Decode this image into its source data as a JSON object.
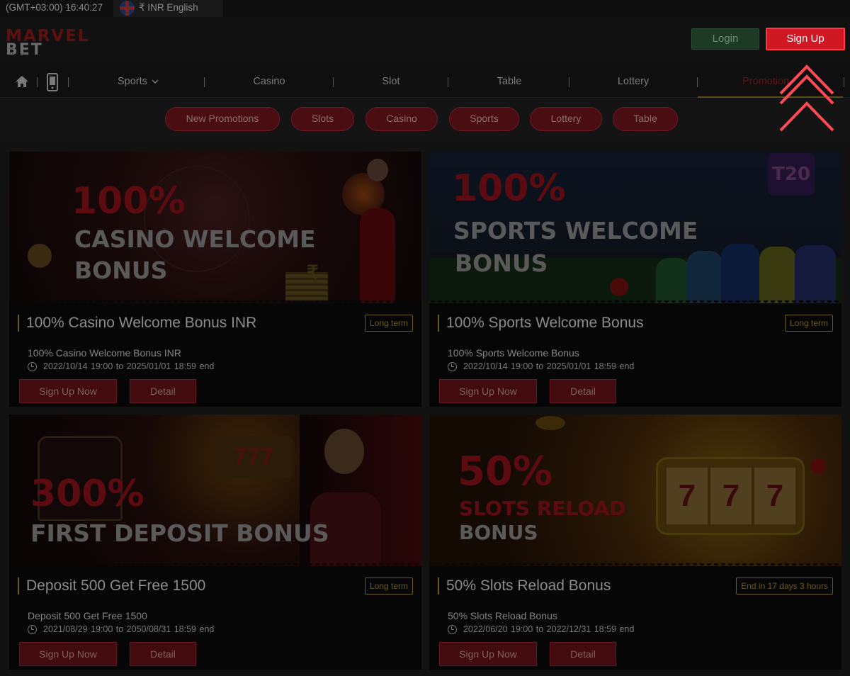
{
  "topbar": {
    "clock": "(GMT+03:00) 16:40:27",
    "currency_language": "₹ INR English",
    "flag_icon": "uk-flag-icon"
  },
  "header": {
    "logo_line1": "MARVEL",
    "logo_line2": "BET",
    "login_label": "Login",
    "signup_label": "Sign Up"
  },
  "nav": {
    "items": [
      {
        "label": "Sports",
        "icon": "chevron-down-icon"
      },
      {
        "label": "Casino"
      },
      {
        "label": "Slot"
      },
      {
        "label": "Table"
      },
      {
        "label": "Lottery"
      },
      {
        "label": "Promotion"
      }
    ],
    "active": "Promotion"
  },
  "filters": [
    "New Promotions",
    "Slots",
    "Casino",
    "Sports",
    "Lottery",
    "Table"
  ],
  "promotions": [
    {
      "banner_big": "100%",
      "banner_line1": "CASINO WELCOME",
      "banner_line2": "BONUS",
      "title": "100% Casino Welcome Bonus INR",
      "tag": "Long term",
      "subtitle": "100% Casino Welcome Bonus INR",
      "dates": "2022/10/14 19:00  to   2025/01/01  18:59  end",
      "signup_label": "Sign Up Now",
      "detail_label": "Detail"
    },
    {
      "banner_big": "100%",
      "banner_line1": "SPORTS WELCOME",
      "banner_line2": "BONUS",
      "banner_badge": "T20",
      "title": "100% Sports Welcome Bonus",
      "tag": "Long term",
      "subtitle": "100% Sports Welcome Bonus",
      "dates": "2022/10/14 19:00  to   2025/01/01  18:59  end",
      "signup_label": "Sign Up Now",
      "detail_label": "Detail"
    },
    {
      "banner_big": "300%",
      "banner_line1": "FIRST DEPOSIT BONUS",
      "banner_line2": "",
      "title": "Deposit 500 Get Free 1500",
      "tag": "Long term",
      "subtitle": "Deposit 500 Get Free 1500",
      "dates": "2021/08/29 19:00  to   2050/08/31  18:59  end",
      "signup_label": "Sign Up Now",
      "detail_label": "Detail"
    },
    {
      "banner_big": "50%",
      "banner_line1": "SLOTS RELOAD",
      "banner_line2": "BONUS",
      "title": "50% Slots Reload Bonus",
      "tag": "End in 17 days 3 hours",
      "subtitle": "50% Slots Reload Bonus",
      "dates": "2022/06/20 19:00  to   2022/12/31  18:59  end",
      "signup_label": "Sign Up Now",
      "detail_label": "Detail"
    }
  ],
  "colors": {
    "accent": "#d01824",
    "gold": "#6b5a1a",
    "login_green": "#1d3a24"
  }
}
